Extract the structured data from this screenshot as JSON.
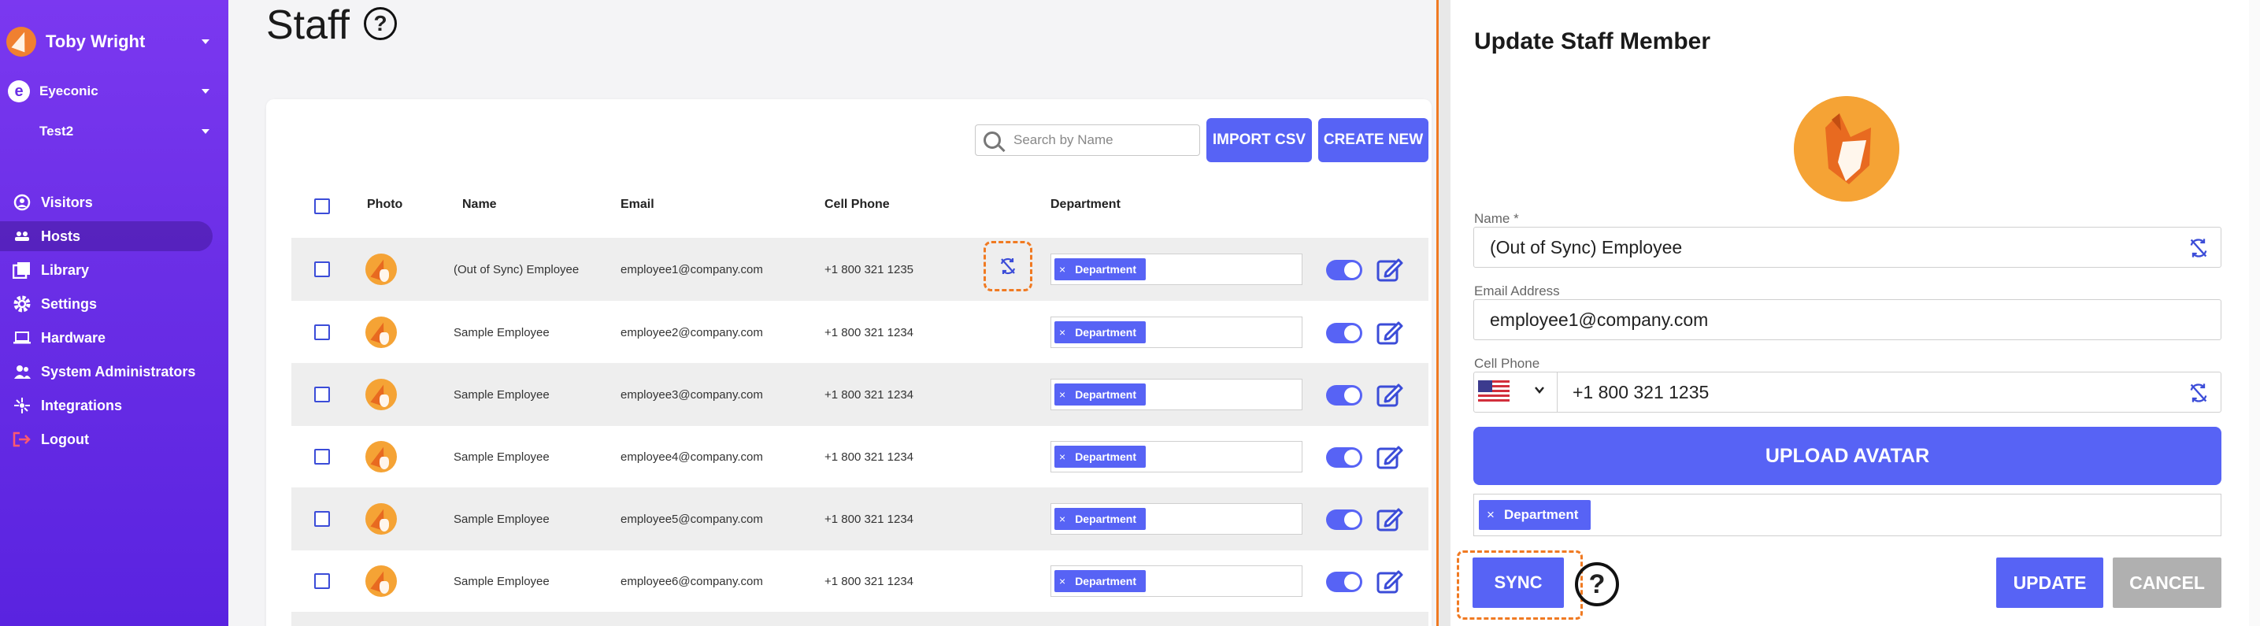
{
  "user": {
    "name": "Toby Wright"
  },
  "org": {
    "initial": "e",
    "name": "Eyeconic"
  },
  "location": {
    "name": "Test2"
  },
  "nav": [
    {
      "label": "Visitors",
      "icon": "visitors-icon",
      "active": false
    },
    {
      "label": "Hosts",
      "icon": "hosts-icon",
      "active": true
    },
    {
      "label": "Library",
      "icon": "library-icon",
      "active": false
    },
    {
      "label": "Settings",
      "icon": "gear-icon",
      "active": false
    },
    {
      "label": "Hardware",
      "icon": "laptop-icon",
      "active": false
    },
    {
      "label": "System Administrators",
      "icon": "admins-icon",
      "active": false
    },
    {
      "label": "Integrations",
      "icon": "integrations-icon",
      "active": false
    },
    {
      "label": "Logout",
      "icon": "logout-icon",
      "active": false
    }
  ],
  "page": {
    "title": "Staff",
    "help": "?"
  },
  "toolbar": {
    "search_placeholder": "Search by Name",
    "import_label": "IMPORT CSV",
    "create_label": "CREATE NEW"
  },
  "table": {
    "headers": {
      "photo": "Photo",
      "name": "Name",
      "email": "Email",
      "phone": "Cell Phone",
      "department": "Department"
    },
    "rows": [
      {
        "name": "(Out of Sync) Employee",
        "email": "employee1@company.com",
        "phone": "+1 800 321 1235",
        "department": "Department",
        "out_of_sync": true,
        "active": true
      },
      {
        "name": "Sample Employee",
        "email": "employee2@company.com",
        "phone": "+1 800 321 1234",
        "department": "Department",
        "out_of_sync": false,
        "active": true
      },
      {
        "name": "Sample Employee",
        "email": "employee3@company.com",
        "phone": "+1 800 321 1234",
        "department": "Department",
        "out_of_sync": false,
        "active": true
      },
      {
        "name": "Sample Employee",
        "email": "employee4@company.com",
        "phone": "+1 800 321 1234",
        "department": "Department",
        "out_of_sync": false,
        "active": true
      },
      {
        "name": "Sample Employee",
        "email": "employee5@company.com",
        "phone": "+1 800 321 1234",
        "department": "Department",
        "out_of_sync": false,
        "active": true
      },
      {
        "name": "Sample Employee",
        "email": "employee6@company.com",
        "phone": "+1 800 321 1234",
        "department": "Department",
        "out_of_sync": false,
        "active": true
      }
    ]
  },
  "modal": {
    "title": "Update Staff Member",
    "name_label": "Name *",
    "name_value": "(Out of Sync) Employee",
    "email_label": "Email Address",
    "email_value": "employee1@company.com",
    "phone_label": "Cell Phone",
    "phone_value": "+1 800 321 1235",
    "upload_label": "UPLOAD AVATAR",
    "department_tag": "Department",
    "sync_label": "SYNC",
    "help": "?",
    "update_label": "UPDATE",
    "cancel_label": "CANCEL"
  },
  "colors": {
    "primary": "#5763f5",
    "sidebar": "#6a2ee6",
    "highlight": "#f07a22",
    "cancel": "#b0b0b0"
  }
}
